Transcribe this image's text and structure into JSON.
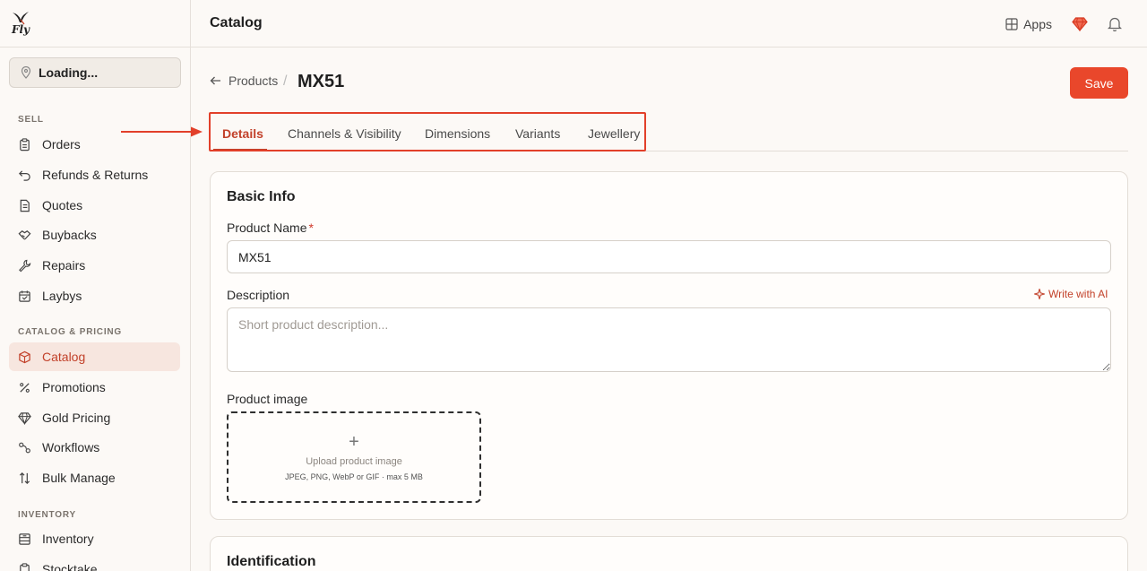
{
  "app": {
    "logo_text": "Fly"
  },
  "sidebar": {
    "location_label": "Loading...",
    "sections": {
      "sell": "SELL",
      "catalog": "CATALOG & PRICING",
      "inventory": "INVENTORY"
    },
    "items": [
      {
        "label": "Orders",
        "icon": "clipboard-icon"
      },
      {
        "label": "Refunds & Returns",
        "icon": "return-icon"
      },
      {
        "label": "Quotes",
        "icon": "document-icon"
      },
      {
        "label": "Buybacks",
        "icon": "handshake-icon"
      },
      {
        "label": "Repairs",
        "icon": "wrench-icon"
      },
      {
        "label": "Laybys",
        "icon": "calendar-icon"
      },
      {
        "label": "Catalog",
        "icon": "package-icon"
      },
      {
        "label": "Promotions",
        "icon": "percent-icon"
      },
      {
        "label": "Gold Pricing",
        "icon": "gem-icon"
      },
      {
        "label": "Workflows",
        "icon": "workflow-icon"
      },
      {
        "label": "Bulk Manage",
        "icon": "sort-arrows-icon"
      },
      {
        "label": "Inventory",
        "icon": "inventory-icon"
      },
      {
        "label": "Stocktake",
        "icon": "clipboard-icon"
      }
    ]
  },
  "topbar": {
    "title": "Catalog",
    "apps_label": "Apps"
  },
  "header": {
    "back_label": "Products",
    "separator": "/",
    "title": "MX51",
    "save_label": "Save"
  },
  "tabs": [
    "Details",
    "Channels & Visibility",
    "Dimensions",
    "Variants",
    "Jewellery"
  ],
  "form": {
    "section_title": "Basic Info",
    "product_name_label": "Product Name",
    "required_mark": "*",
    "product_name_value": "MX51",
    "description_label": "Description",
    "write_ai_label": "Write with AI",
    "description_placeholder": "Short product description...",
    "image_label": "Product image",
    "upload_plus": "+",
    "upload_label": "Upload product image",
    "upload_hint": "JPEG, PNG, WebP or GIF · max 5 MB",
    "next_section_title": "Identification"
  },
  "colors": {
    "accent": "#e9472b",
    "accent_text": "#c2412a",
    "highlight_box": "#e2402a"
  }
}
